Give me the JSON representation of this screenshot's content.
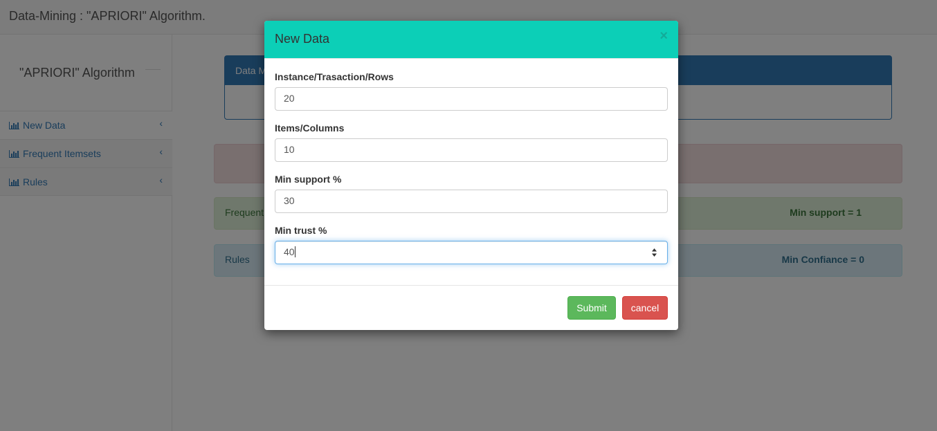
{
  "app": {
    "title": "Data-Mining : \"APRIORI\" Algorithm."
  },
  "sidebar": {
    "title": "\"APRIORI\" Algorithm",
    "items": [
      {
        "label": "New Data",
        "icon": "bar-chart-icon"
      },
      {
        "label": "Frequent Itemsets",
        "icon": "bar-chart-icon"
      },
      {
        "label": "Rules",
        "icon": "bar-chart-icon"
      }
    ]
  },
  "main": {
    "data_panel": {
      "title_partial": "Data M"
    },
    "frequent_bar": {
      "label_partial": "Frequent",
      "min_support": "Min support = 1"
    },
    "rules_bar": {
      "label": "Rules",
      "min_confidence": "Min Confiance = 0"
    }
  },
  "modal": {
    "title": "New Data",
    "close_symbol": "×",
    "fields": [
      {
        "label": "Instance/Trasaction/Rows",
        "value": "20"
      },
      {
        "label": "Items/Columns",
        "value": "10"
      },
      {
        "label": "Min support %",
        "value": "30"
      },
      {
        "label": "Min trust %",
        "value": "40"
      }
    ],
    "submit_label": "Submit",
    "cancel_label": "cancel"
  },
  "colors": {
    "modal_header": "#0ccfb7",
    "primary": "#337ab7",
    "success": "#5cb85c",
    "danger": "#d9534f"
  }
}
